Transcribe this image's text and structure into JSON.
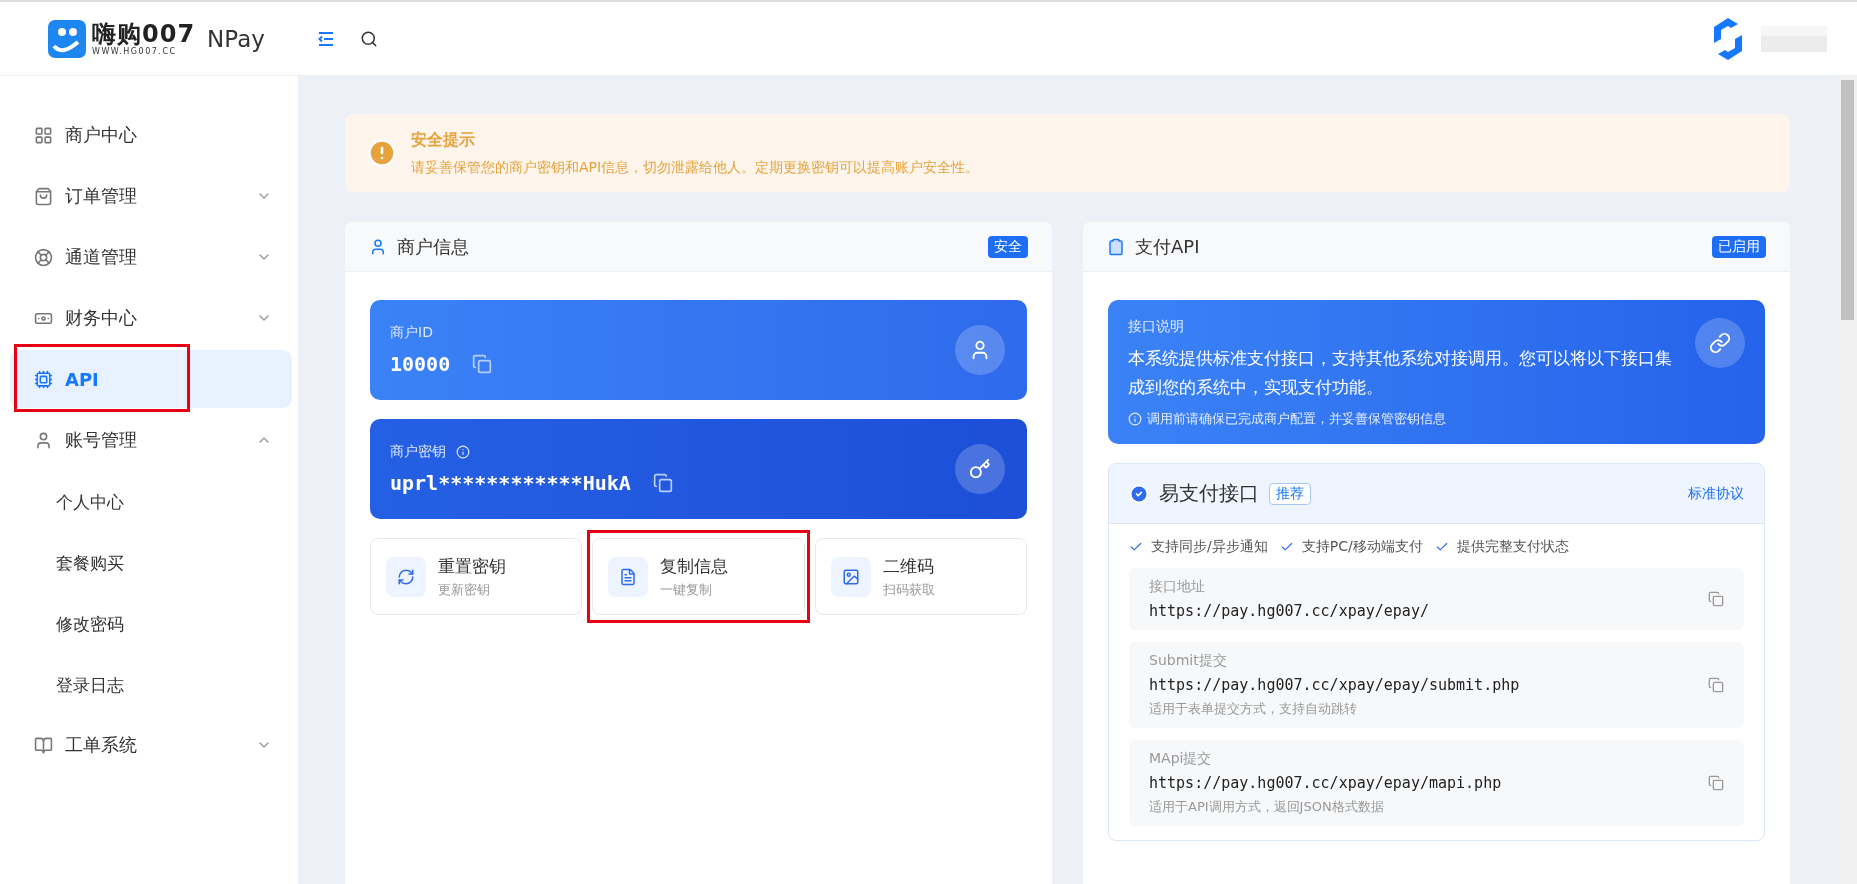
{
  "header": {
    "logo_title": "嗨购007",
    "logo_subtitle": "WWW.HG007.CC",
    "product": "NPay"
  },
  "sidebar": {
    "items": [
      {
        "label": "商户中心",
        "kind": "link",
        "selected": false,
        "highlighted": false
      },
      {
        "label": "订单管理",
        "kind": "group",
        "selected": false,
        "expanded": false,
        "highlighted": false
      },
      {
        "label": "通道管理",
        "kind": "group",
        "selected": false,
        "expanded": false,
        "highlighted": false
      },
      {
        "label": "财务中心",
        "kind": "group",
        "selected": false,
        "expanded": false,
        "highlighted": false
      },
      {
        "label": "API",
        "kind": "link",
        "selected": true,
        "highlighted": true
      },
      {
        "label": "账号管理",
        "kind": "group",
        "selected": false,
        "expanded": true,
        "highlighted": false,
        "children": [
          {
            "label": "个人中心",
            "selected": false
          },
          {
            "label": "套餐购买",
            "selected": false
          },
          {
            "label": "修改密码",
            "selected": false
          },
          {
            "label": "登录日志",
            "selected": false
          }
        ]
      },
      {
        "label": "工单系统",
        "kind": "group",
        "selected": false,
        "expanded": false,
        "highlighted": false
      }
    ]
  },
  "alert": {
    "title": "安全提示",
    "message": "请妥善保管您的商户密钥和API信息，切勿泄露给他人。定期更换密钥可以提高账户安全性。"
  },
  "merchant_card": {
    "title": "商户信息",
    "badge": "安全",
    "fields": [
      {
        "kind": "id",
        "label": "商户ID",
        "value": "10000"
      },
      {
        "kind": "secret",
        "label": "商户密钥",
        "value": "uprl************HukA"
      }
    ],
    "actions": [
      {
        "title": "重置密钥",
        "subtitle": "更新密钥",
        "highlighted": false
      },
      {
        "title": "复制信息",
        "subtitle": "一键复制",
        "highlighted": true
      },
      {
        "title": "二维码",
        "subtitle": "扫码获取",
        "highlighted": false
      }
    ]
  },
  "api_card": {
    "title": "支付API",
    "badge": "已启用",
    "intro": {
      "label": "接口说明",
      "text": "本系统提供标准支付接口，支持其他系统对接调用。您可以将以下接口集成到您的系统中，实现支付功能。",
      "note": "调用前请确保已完成商户配置，并妥善保管密钥信息"
    },
    "interface": {
      "title": "易支付接口",
      "tag": "推荐",
      "link": "标准协议",
      "features": [
        "支持同步/异步通知",
        "支持PC/移动端支付",
        "提供完整支付状态"
      ],
      "endpoints": [
        {
          "label": "接口地址",
          "url": "https://pay.hg007.cc/xpay/epay/"
        },
        {
          "label": "Submit提交",
          "url": "https://pay.hg007.cc/xpay/epay/submit.php",
          "note": "适用于表单提交方式，支持自动跳转"
        },
        {
          "label": "MApi提交",
          "url": "https://pay.hg007.cc/xpay/epay/mapi.php",
          "note": "适用于API调用方式，返回JSON格式数据"
        }
      ]
    }
  }
}
